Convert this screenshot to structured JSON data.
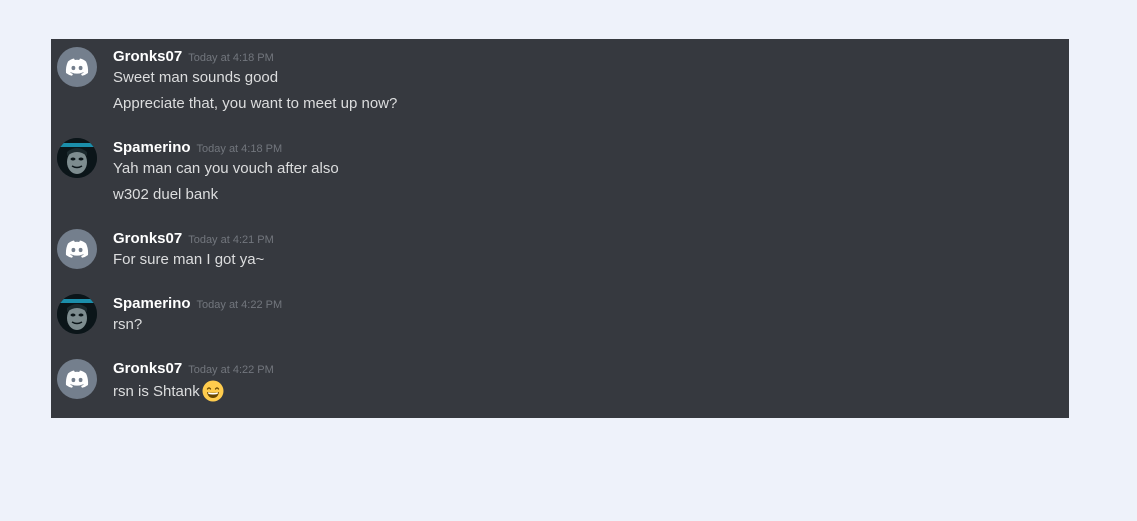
{
  "messages": [
    {
      "author": "Gronks07",
      "avatar": "discord-logo-icon",
      "timestamp": "Today at 4:18 PM",
      "lines": [
        "Sweet man sounds good",
        "Appreciate that, you want to meet up now?"
      ]
    },
    {
      "author": "Spamerino",
      "avatar": "masked-face-avatar",
      "timestamp": "Today at 4:18 PM",
      "lines": [
        "Yah man can you vouch after also",
        "w302 duel bank"
      ]
    },
    {
      "author": "Gronks07",
      "avatar": "discord-logo-icon",
      "timestamp": "Today at 4:21 PM",
      "lines": [
        "For sure man I got ya~"
      ]
    },
    {
      "author": "Spamerino",
      "avatar": "masked-face-avatar",
      "timestamp": "Today at 4:22 PM",
      "lines": [
        "rsn?"
      ]
    },
    {
      "author": "Gronks07",
      "avatar": "discord-logo-icon",
      "timestamp": "Today at 4:22 PM",
      "lines": [
        "rsn is Shtank"
      ],
      "trailing_emoji": "grinning-smile-emoji"
    }
  ],
  "colors": {
    "background": "#eef2fa",
    "chat_bg": "#36393f",
    "username": "#ffffff",
    "text": "#dcddde",
    "timestamp": "#72767d",
    "discord_avatar_bg": "#747f8d"
  }
}
